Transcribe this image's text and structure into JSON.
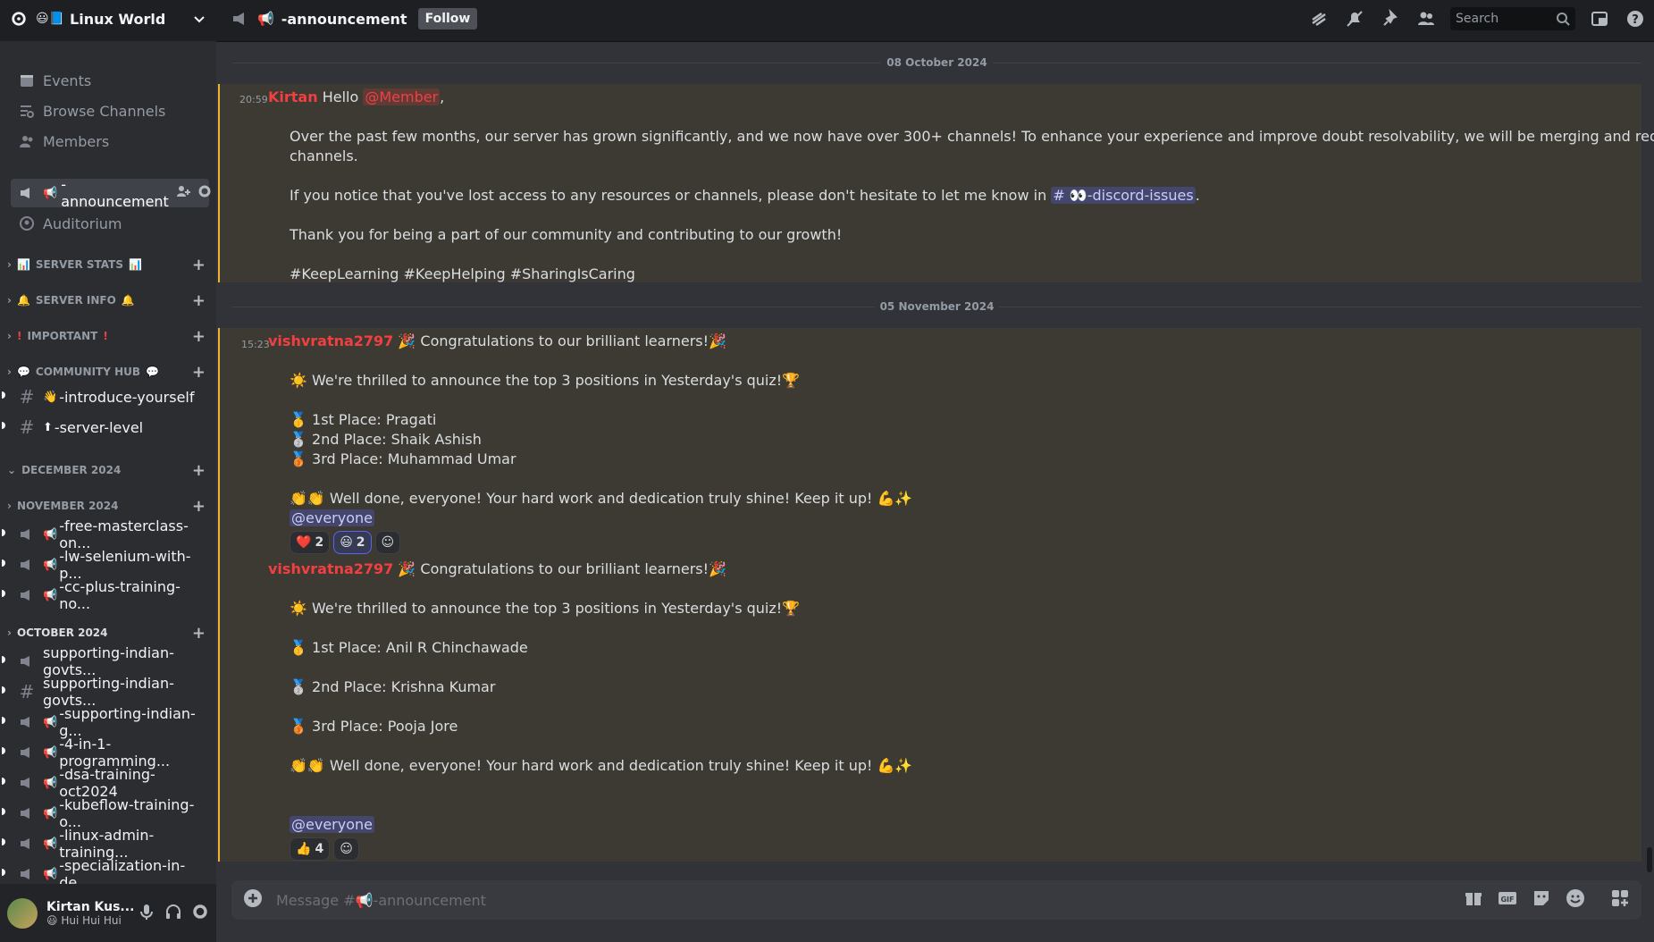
{
  "server": {
    "name": "Linux World",
    "emoji": "😃📘"
  },
  "channel_header": {
    "name": "-announcement",
    "follow_label": "Follow",
    "search_placeholder": "Search"
  },
  "sidebar": {
    "top_items": [
      {
        "label": "Events"
      },
      {
        "label": "Browse Channels"
      },
      {
        "label": "Members"
      }
    ],
    "active_channel": "-announcement",
    "auditorium": "Auditorium",
    "categories": {
      "server_stats": "SERVER STATS",
      "server_info": "SERVER INFO",
      "important": "IMPORTANT",
      "community_hub": "COMMUNITY HUB",
      "december": "DECEMBER 2024",
      "november": "NOVEMBER 2024",
      "october": "OCTOBER 2024"
    },
    "community_channels": [
      "-introduce-yourself",
      "-server-level"
    ],
    "november_channels": [
      "-free-masterclass-on...",
      "-lw-selenium-with-p...",
      "-cc-plus-training-no..."
    ],
    "october_channels": [
      "supporting-indian-govts...",
      "supporting-indian-govts...",
      "-supporting-indian-g...",
      "-4-in-1-programming...",
      "-dsa-training-oct2024",
      "-kubeflow-training-o...",
      "-linux-admin-training...",
      "-specialization-in-de..."
    ]
  },
  "user": {
    "name": "Kirtan Kus...",
    "status": "Hui Hui Hui"
  },
  "dates": {
    "d1": "08 October 2024",
    "d2": "05 November 2024"
  },
  "message1": {
    "time": "20:59",
    "author": "Kirtan",
    "hello": "Hello",
    "mention": "@Member",
    "comma": ",",
    "p1a": "Over the past few months, our server has grown significantly, and we now have over 300+ channels! To enhance your experience and improve doubt resolvability, we will be merging and reorganizing some of the",
    "p1b": "channels.",
    "p2a": "If you notice that you've lost access to any resources or channels, please don't hesitate to let me know in",
    "p2_channel": "# 👀-discord-issues",
    "p2_end": ".",
    "p3": "Thank you for being a part of our community and contributing to our growth!",
    "p4": "#KeepLearning #KeepHelping #SharingIsCaring"
  },
  "message2": {
    "time": "15:23",
    "author": "vishvratna2797",
    "title": "🎉 Congratulations to our brilliant learners!🎉",
    "intro": "☀️ We're thrilled to announce the top 3 positions in Yesterday's quiz!🏆",
    "first": "1st Place: Pragati",
    "second": "2nd Place: Shaik Ashish",
    "third": "3rd Place: Muhammad Umar",
    "welldone": "👏👏 Well done, everyone! Your hard work and dedication truly shine! Keep it up! 💪✨",
    "everyone": "@everyone",
    "reactions": [
      {
        "emoji": "❤️",
        "count": "2"
      },
      {
        "emoji": "😃",
        "count": "2"
      }
    ]
  },
  "message3": {
    "author": "vishvratna2797",
    "title": "🎉 Congratulations to our brilliant learners!🎉",
    "intro": "☀️ We're thrilled to announce the top 3 positions in Yesterday's quiz!🏆",
    "first": "1st Place: Anil R Chinchawade",
    "second": "2nd Place: Krishna Kumar",
    "third": "3rd Place: Pooja Jore",
    "welldone": "👏👏 Well done, everyone! Your hard work and dedication truly shine! Keep it up! 💪✨",
    "everyone": "@everyone",
    "reactions": [
      {
        "emoji": "👍",
        "count": "4"
      }
    ]
  },
  "composer": {
    "placeholder": "Message #📢-announcement"
  },
  "colors": {
    "accent": "#5865f2",
    "author": "#f23f42",
    "highlight_border": "#f0b232"
  }
}
